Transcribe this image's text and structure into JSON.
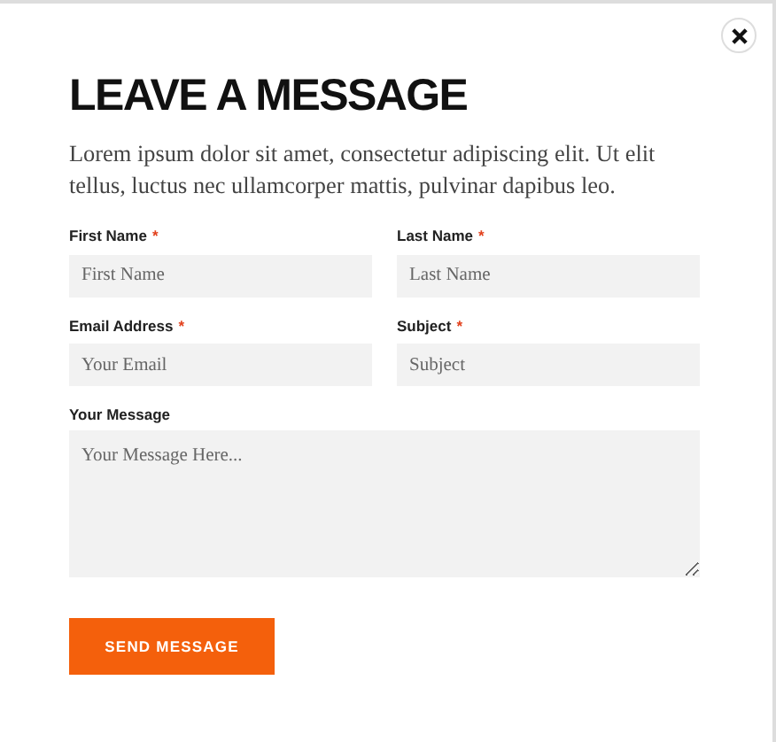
{
  "title": "LEAVE A MESSAGE",
  "intro": "Lorem ipsum dolor sit amet, consectetur adipiscing elit. Ut elit tellus, luctus nec ullamcorper mattis, pulvinar dapibus leo.",
  "fields": [
    {
      "kind": "input",
      "label": "First Name",
      "required_mark": "*",
      "placeholder": "First Name"
    },
    {
      "kind": "input",
      "label": "Last Name",
      "required_mark": "*",
      "placeholder": "Last Name"
    },
    {
      "kind": "input",
      "label": "Email Address",
      "required_mark": "*",
      "placeholder": "Your Email"
    },
    {
      "kind": "input",
      "label": "Subject",
      "required_mark": "*",
      "placeholder": "Subject"
    },
    {
      "kind": "textarea",
      "label": "Your Message",
      "placeholder": "Your Message Here..."
    }
  ],
  "submit": "SEND MESSAGE"
}
